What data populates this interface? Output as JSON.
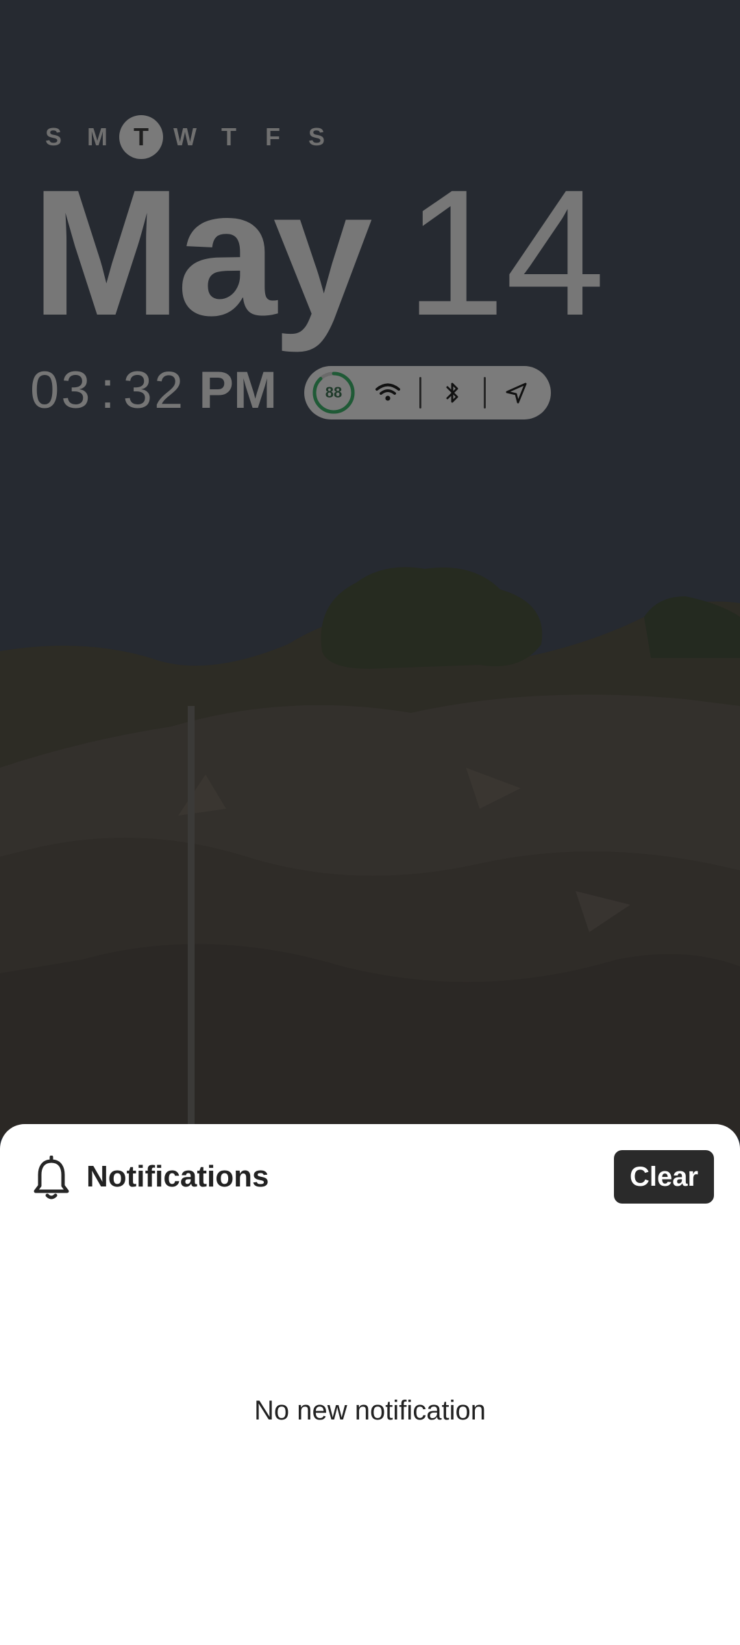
{
  "lockscreen": {
    "week_days": [
      "S",
      "M",
      "T",
      "W",
      "T",
      "F",
      "S"
    ],
    "today_index": 2,
    "month": "May",
    "day": "14",
    "time": {
      "hour": "03",
      "minute": "32",
      "colon": ":",
      "ampm": "PM"
    },
    "status": {
      "battery_level": "88",
      "icons": [
        "wifi-icon",
        "bluetooth-icon",
        "location-icon"
      ]
    }
  },
  "notifications": {
    "title": "Notifications",
    "clear_label": "Clear",
    "empty_text": "No new notification"
  },
  "colors": {
    "scrim": "#23272e",
    "text_dim": "#777777",
    "sheet_bg": "#ffffff",
    "clear_button_bg": "#2a2a2a",
    "battery_ring": "#1f5a36"
  }
}
